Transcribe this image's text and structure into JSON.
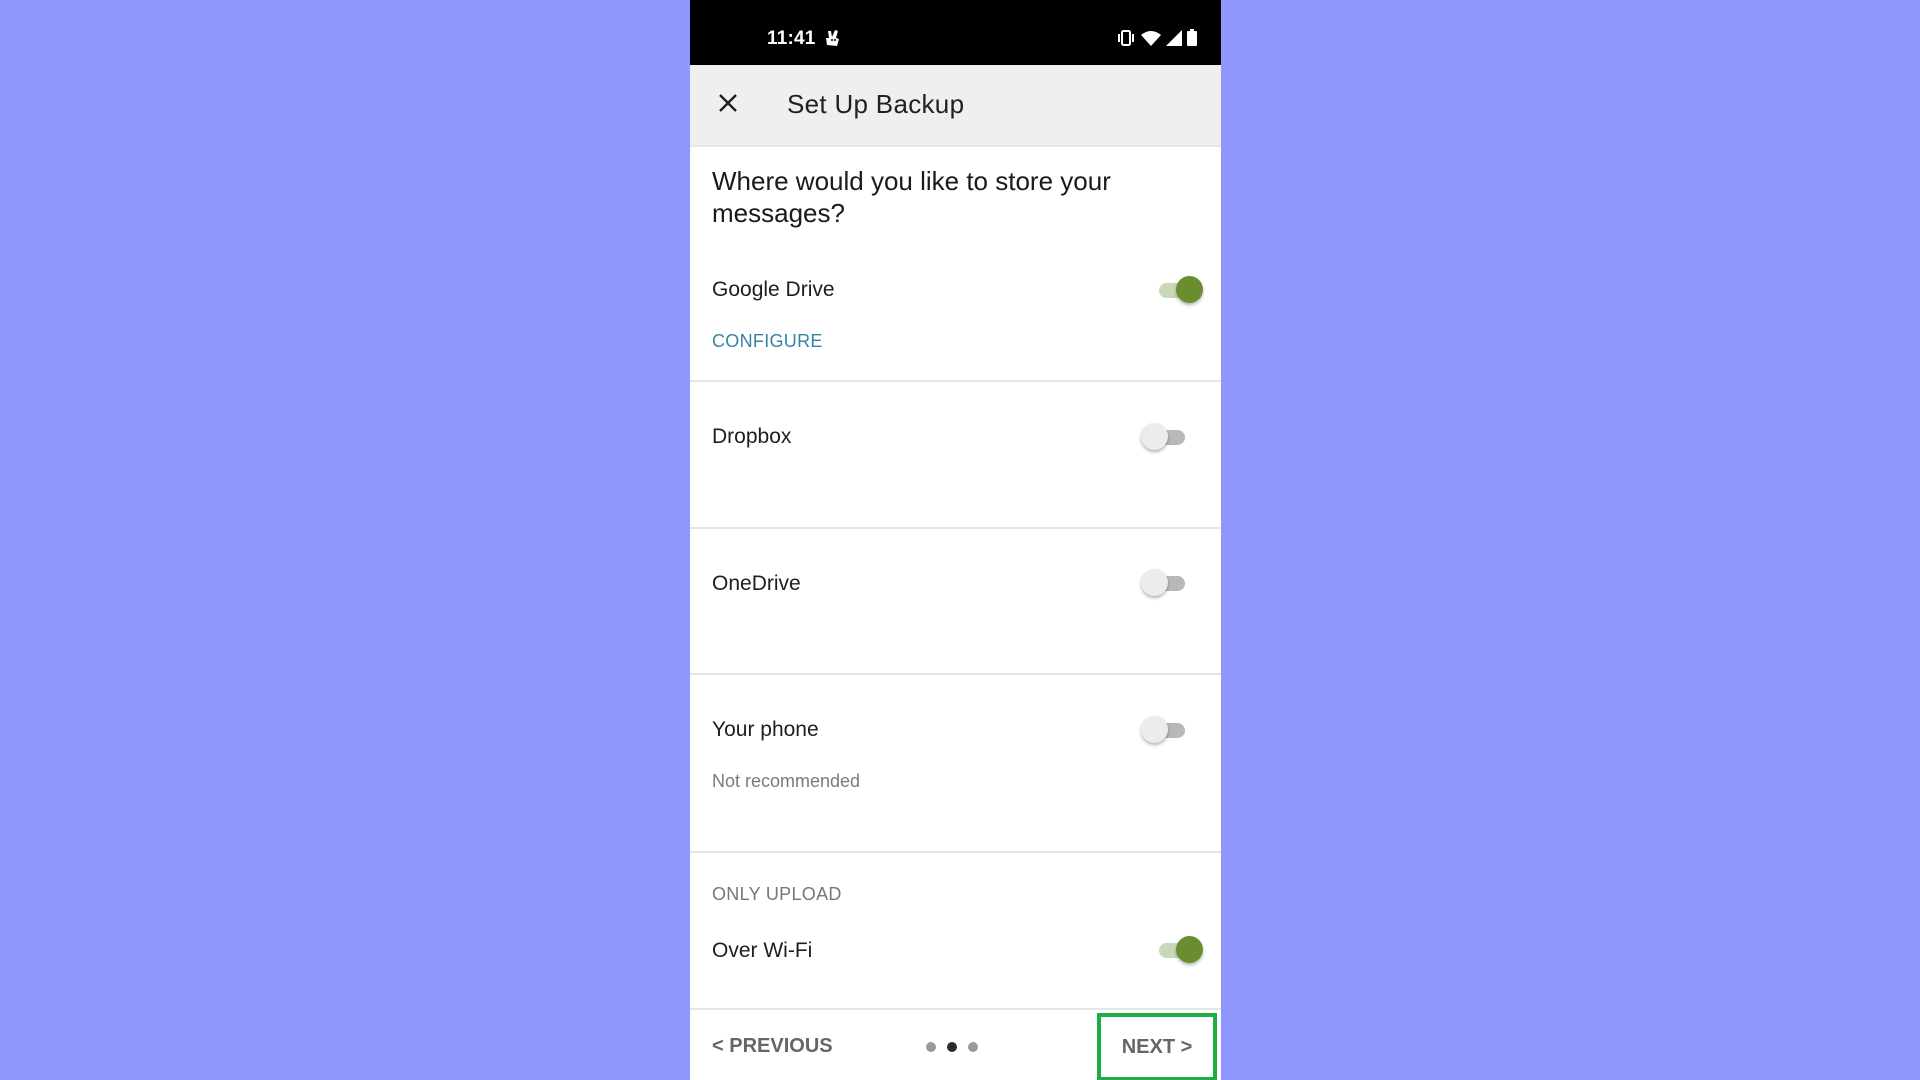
{
  "status_bar": {
    "time": "11:41",
    "icons": [
      "notification-app-icon",
      "vibrate-icon",
      "wifi-icon",
      "cell-signal-icon",
      "battery-icon"
    ]
  },
  "app_bar": {
    "close_icon": "close-icon",
    "title": "Set Up Backup"
  },
  "question": "Where would you like to store your messages?",
  "storage_options": [
    {
      "label": "Google Drive",
      "enabled": true,
      "link": "CONFIGURE"
    },
    {
      "label": "Dropbox",
      "enabled": false
    },
    {
      "label": "OneDrive",
      "enabled": false
    },
    {
      "label": "Your phone",
      "enabled": false,
      "note": "Not recommended"
    }
  ],
  "upload_section": {
    "header": "ONLY UPLOAD",
    "options": [
      {
        "label": "Over Wi-Fi",
        "enabled": true
      }
    ]
  },
  "footer": {
    "previous_label": "< PREVIOUS",
    "next_label": "NEXT >",
    "pages_total": 3,
    "current_page": 2
  },
  "colors": {
    "background": "#8f97ff",
    "toggle_on": "#6a8e2f",
    "link": "#3a82a4",
    "highlight_box": "#1fab45"
  }
}
